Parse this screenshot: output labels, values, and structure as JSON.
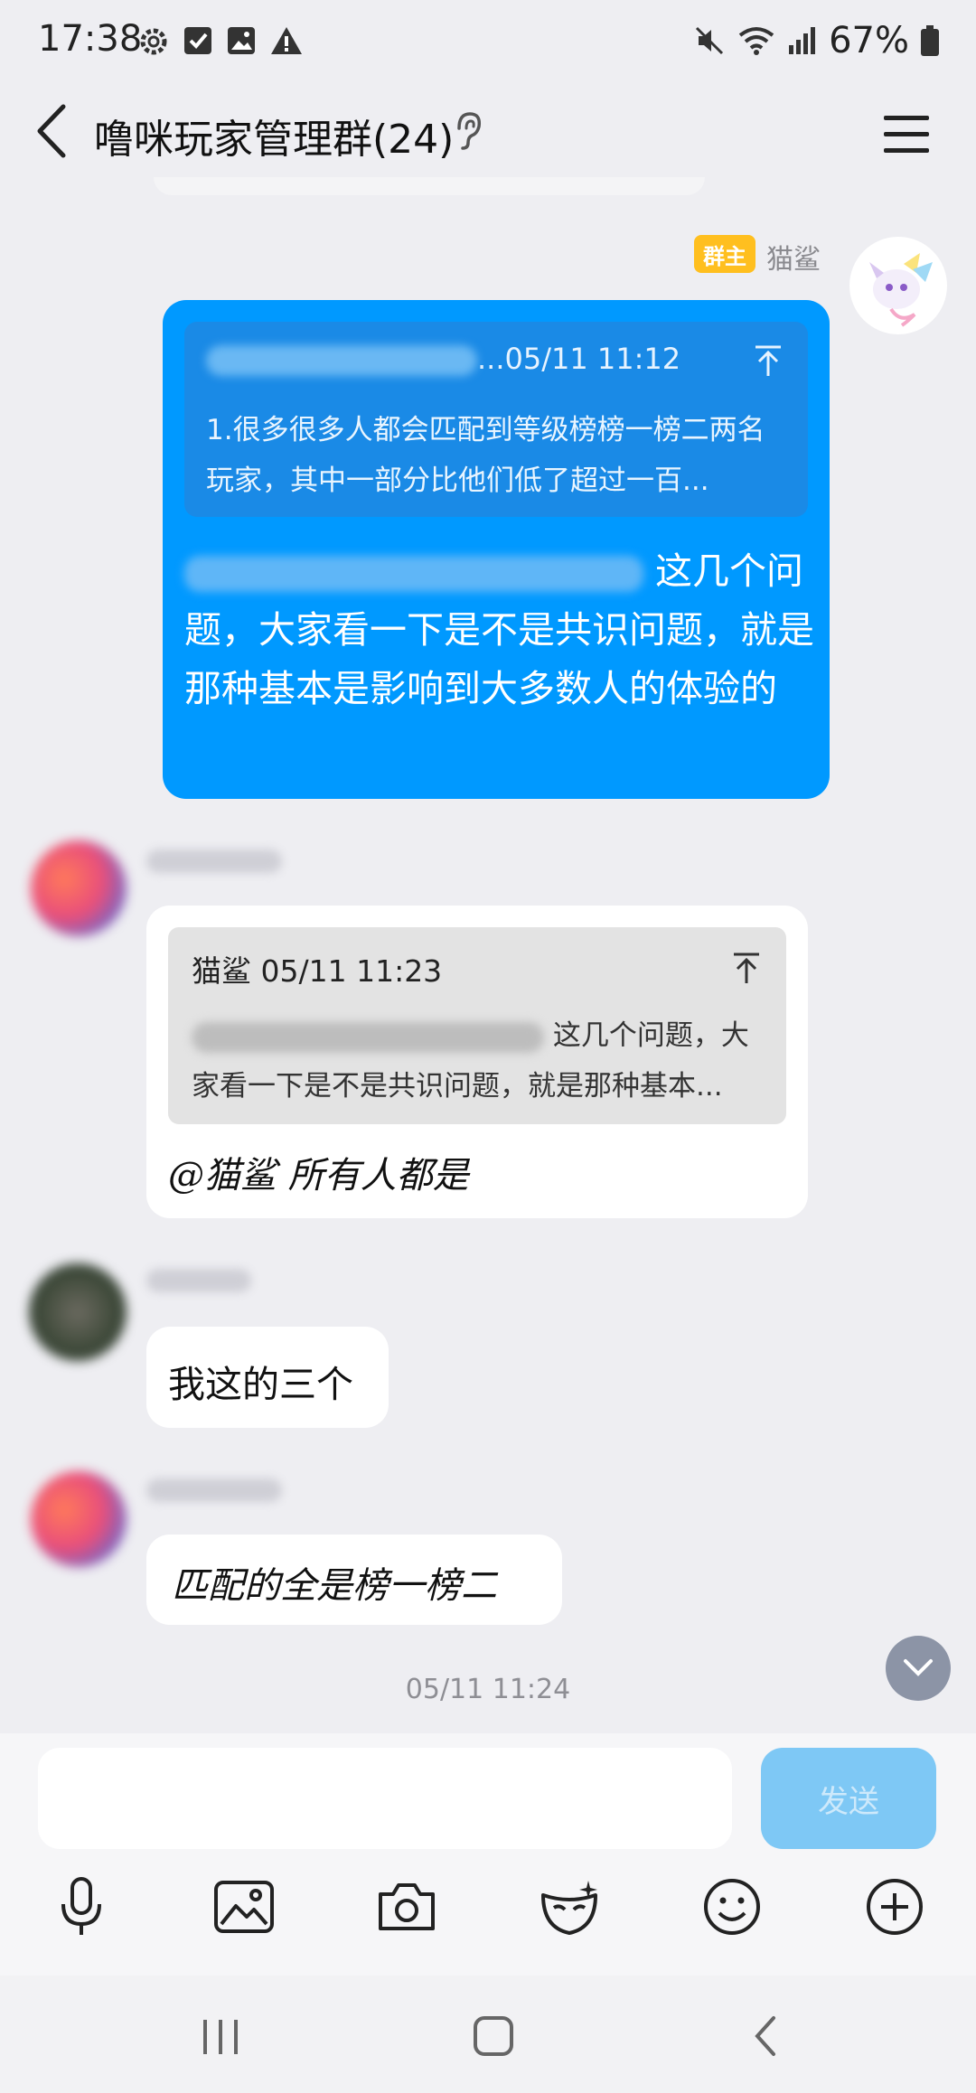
{
  "status_bar": {
    "time": "17:38",
    "battery": "67%",
    "icons_left": [
      "gear-icon",
      "checkbox-icon",
      "image-icon",
      "warning-icon"
    ],
    "icons_right": [
      "mute-icon",
      "wifi-icon",
      "signal-icon",
      "battery-icon"
    ]
  },
  "header": {
    "title": "噜咪玩家管理群(24)"
  },
  "messages": [
    {
      "sender_badge": "群主",
      "sender_name": "猫鲨",
      "quote_header_suffix": "...05/11 11:12",
      "quote_text": "1.很多很多人都会匹配到等级榜榜一榜二两名玩家，其中一部分比他们低了超过一百...",
      "text_suffix": "这几个问题，大家看一下是不是共识问题，就是那种基本是影响到大多数人的体验的"
    },
    {
      "quote_header": "猫鲨 05/11 11:23",
      "quote_text_suffix": "这几个问题，大",
      "quote_text_line2": "家看一下是不是共识问题，就是那种基本...",
      "text": "@猫鲨 所有人都是"
    },
    {
      "text": "我这的三个"
    },
    {
      "text": "匹配的全是榜一榜二"
    }
  ],
  "timestamp": "05/11 11:24",
  "input": {
    "placeholder": "",
    "send_label": "发送"
  },
  "toolbar": [
    "mic-icon",
    "gallery-icon",
    "camera-icon",
    "mask-icon",
    "emoji-icon",
    "plus-icon"
  ],
  "colors": {
    "self_bubble": "#0099ff",
    "owner_badge": "#ffbf1f",
    "send_button": "#7ec8f5",
    "background": "#eeeef2"
  }
}
